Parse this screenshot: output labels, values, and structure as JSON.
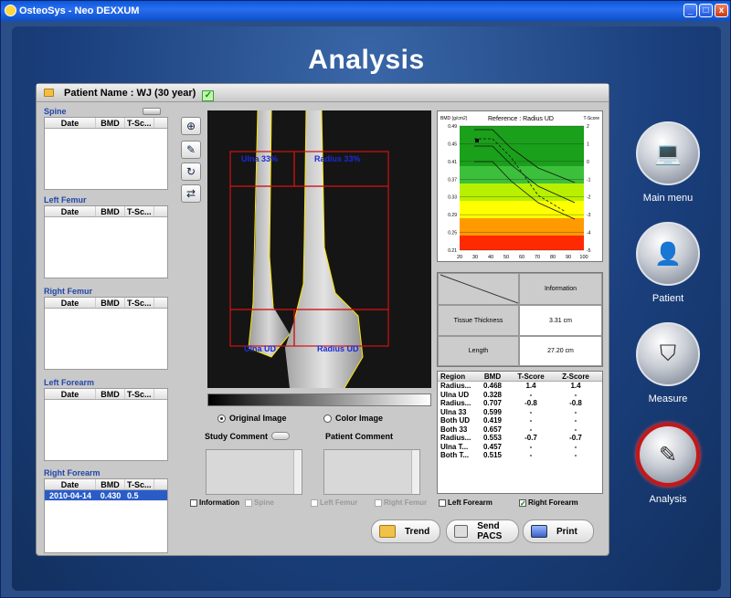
{
  "window": {
    "title": "OsteoSys - Neo DEXXUM",
    "min": "_",
    "max": "□",
    "close": "x"
  },
  "heading": "Analysis",
  "patient": {
    "label": "Patient Name",
    "value": ": WJ (30 year)"
  },
  "cols": {
    "date": "Date",
    "bmd": "BMD",
    "tscore": "T-Sc..."
  },
  "sections": [
    {
      "title": "Spine",
      "rows": []
    },
    {
      "title": "Left Femur",
      "rows": []
    },
    {
      "title": "Right Femur",
      "rows": []
    },
    {
      "title": "Left Forearm",
      "rows": []
    },
    {
      "title": "Right Forearm",
      "rows": [
        {
          "date": "2010-04-14",
          "bmd": "0.430",
          "t": "0.5"
        }
      ]
    }
  ],
  "roi": {
    "ulna33": "Ulna 33%",
    "radius33": "Radius 33%",
    "ulnaUD": "Ulna UD",
    "radiusUD": "Radius UD"
  },
  "image_mode": {
    "original": "Original Image",
    "color": "Color Image",
    "selected": "original"
  },
  "comments": {
    "study": "Study Comment",
    "patient": "Patient Comment"
  },
  "chart": {
    "title": "Reference : Radius UD",
    "unit": "BMD (g/cm2)",
    "tscore_label": "T-Score",
    "y_ticks": [
      "0.49",
      "0.45",
      "0.41",
      "0.37",
      "0.33",
      "0.29",
      "0.25",
      "0.21"
    ],
    "t_ticks": [
      "2",
      "1",
      "0",
      "-1",
      "-2",
      "-3",
      "-4",
      "-5"
    ],
    "x_ticks": [
      "20",
      "30",
      "40",
      "50",
      "60",
      "70",
      "80",
      "90",
      "100"
    ]
  },
  "info": {
    "header": "Information",
    "rows": [
      {
        "label": "Tissue Thickness",
        "value": "3.31 cm"
      },
      {
        "label": "Length",
        "value": "27.20 cm"
      }
    ]
  },
  "regions": {
    "headers": [
      "Region",
      "BMD",
      "T-Score",
      "Z-Score"
    ],
    "rows": [
      [
        "Radius...",
        "0.468",
        "1.4",
        "1.4"
      ],
      [
        "Ulna UD",
        "0.328",
        "-",
        "-"
      ],
      [
        "Radius...",
        "0.707",
        "-0.8",
        "-0.8"
      ],
      [
        "Ulna 33",
        "0.599",
        "-",
        "-"
      ],
      [
        "Both UD",
        "0.419",
        "-",
        "-"
      ],
      [
        "Both 33",
        "0.657",
        "-",
        "-"
      ],
      [
        "Radius...",
        "0.553",
        "-0.7",
        "-0.7"
      ],
      [
        "Ulna T...",
        "0.457",
        "-",
        "-"
      ],
      [
        "Both T...",
        "0.515",
        "-",
        "-"
      ]
    ]
  },
  "report_checks": [
    "Information",
    "Spine",
    "Left Femur",
    "Right Femur",
    "Left Forearm",
    "Right Forearm"
  ],
  "buttons": {
    "trend": "Trend",
    "send_pacs": "Send PACS",
    "print": "Print"
  },
  "nav": [
    "Main menu",
    "Patient",
    "Measure",
    "Analysis"
  ]
}
